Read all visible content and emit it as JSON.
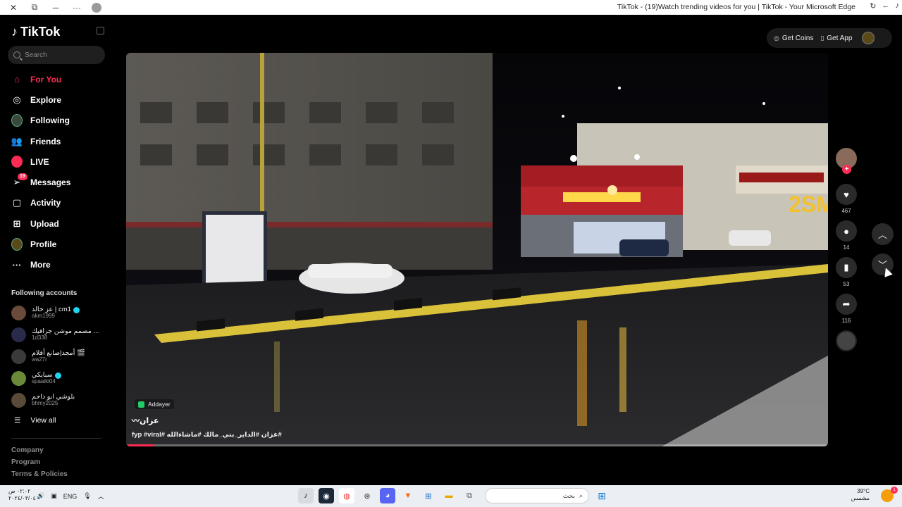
{
  "browser": {
    "title": "TikTok - (19)Watch trending videos for you | TikTok - Your Microsoft Edge",
    "close_glyph": "✕",
    "restore_glyph": "⧉",
    "minimize_glyph": "─",
    "more_glyph": "···"
  },
  "sidebar": {
    "logo_text": "TikTok",
    "search_placeholder": "Search",
    "nav_items": [
      {
        "label": "For You",
        "icon": "home-icon",
        "glyph": "⌂",
        "active": true
      },
      {
        "label": "Explore",
        "icon": "compass-icon",
        "glyph": "◎"
      },
      {
        "label": "Following",
        "icon": "avatar-icon",
        "glyph": ""
      },
      {
        "label": "Friends",
        "icon": "friends-icon",
        "glyph": "👥"
      },
      {
        "label": "LIVE",
        "icon": "live-icon",
        "glyph": "●"
      },
      {
        "label": "Messages",
        "icon": "messages-icon",
        "glyph": "➢",
        "badge": "19"
      },
      {
        "label": "Activity",
        "icon": "activity-icon",
        "glyph": "▢"
      },
      {
        "label": "Upload",
        "icon": "upload-icon",
        "glyph": "⊞"
      },
      {
        "label": "Profile",
        "icon": "profile-avatar-icon",
        "glyph": ""
      },
      {
        "label": "More",
        "icon": "more-icon",
        "glyph": "···"
      }
    ],
    "following_title": "Following accounts",
    "following_accounts": [
      {
        "name": "عز خالد | cm1",
        "handle": "akm1999",
        "verified": true,
        "avatar_color": "#6a4a3a"
      },
      {
        "name": "مصمم موشن جرافيك ...",
        "handle": "1d338",
        "verified": false,
        "avatar_color": "#2a2a4a"
      },
      {
        "name": "أمجد|صانع أفلام 🎬",
        "handle": "wa27r",
        "verified": false,
        "avatar_color": "#3a3a3a"
      },
      {
        "name": "سبايكي",
        "handle": "spaaiki04",
        "verified": true,
        "avatar_color": "#6a8a3a"
      },
      {
        "name": "بلوشي ابو داحم",
        "handle": "bhmy2025",
        "verified": false,
        "avatar_color": "#5a4a3a"
      }
    ],
    "view_all": "View all",
    "footer_links": [
      "Company",
      "Program",
      "Terms & Policies"
    ]
  },
  "header": {
    "get_coins": "Get Coins",
    "get_app": "Get App"
  },
  "video": {
    "author": "Addayer",
    "title": "عزان〰",
    "tags": "#عزان #الداير_بني_مالك #ماشاءالله #fyp #viral",
    "watermark": "2SM",
    "progress": 0.04
  },
  "actions": {
    "likes": "467",
    "comments": "14",
    "saves": "53",
    "shares": "116"
  },
  "taskbar": {
    "time": "٠٢:٠٢ ص",
    "date": "٢٠٢٤/٠٣/٠٤",
    "language": "ENG",
    "search_placeholder": "بحث",
    "temperature": "39°C",
    "weather": "مشمس",
    "notif_count": "1"
  },
  "colors": {
    "accent": "#fe2c55",
    "verified": "#20d5ec"
  }
}
